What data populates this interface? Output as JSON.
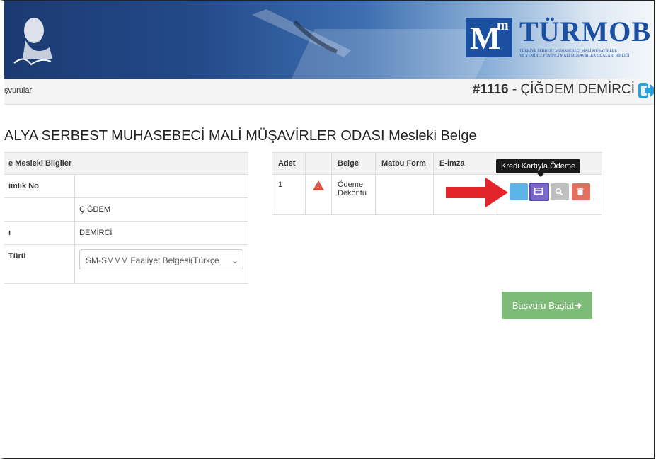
{
  "header": {
    "logo_mark": "M",
    "logo_mark_sup": "m",
    "logo_word": "TÜRMOB",
    "logo_sub_line1": "TÜRKİYE SERBEST MUHASEBECİ MALİ MÜŞAVİRLER",
    "logo_sub_line2": "VE YEMİNLİ YEMİNLİ MALİ MÜŞAVİRLER ODALARI BİRLİĞİ"
  },
  "breadcrumb": {
    "text": "şvurular"
  },
  "user": {
    "id": "#1116",
    "separator": " - ",
    "name": "ÇİĞDEM DEMİRCİ"
  },
  "page": {
    "title": "ALYA SERBEST MUHASEBECİ MALİ MÜŞAVİRLER ODASI Mesleki Belge"
  },
  "info_table": {
    "header": "e Mesleki Bilgiler",
    "rows": [
      {
        "label": "imlik No",
        "value": ""
      },
      {
        "label": "",
        "value": "ÇİĞDEM"
      },
      {
        "label": "ı",
        "value": "DEMİRCİ"
      },
      {
        "label": "Türü",
        "value": ""
      }
    ],
    "select_value": "SM-SMMM Faaliyet Belgesi(Türkçe"
  },
  "docs_table": {
    "columns": [
      "Adet",
      "",
      "Belge",
      "Matbu Form",
      "E-İmza",
      ""
    ],
    "rows": [
      {
        "adet": "1",
        "belge_line1": "Ödeme",
        "belge_line2": "Dekontu"
      }
    ]
  },
  "tooltip": {
    "text": "Kredi Kartıyla Ödeme"
  },
  "actions": {
    "start_label": "Başvuru Başlat"
  },
  "colors": {
    "brand": "#1b4fa0",
    "pay": "#7b68c4",
    "view": "#c0c0c0",
    "delete": "#e36f61",
    "start": "#7dbb78",
    "arrow": "#e2252b"
  }
}
